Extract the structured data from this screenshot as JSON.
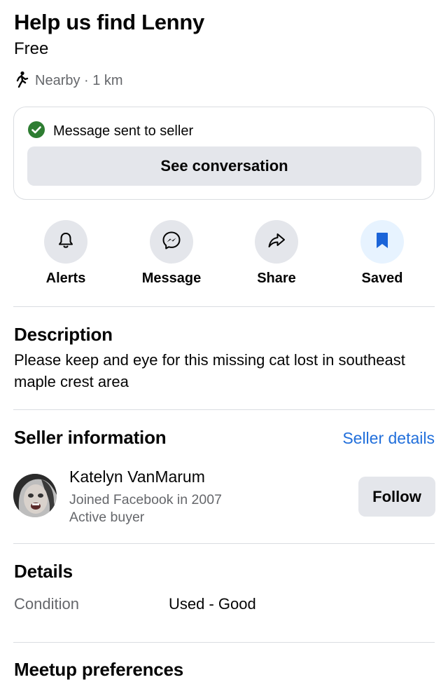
{
  "listing": {
    "title": "Help us find Lenny",
    "price": "Free",
    "distance": "Nearby · 1 km"
  },
  "message_card": {
    "status": "Message sent to seller",
    "button_label": "See conversation"
  },
  "actions": [
    {
      "label": "Alerts",
      "icon": "bell-icon"
    },
    {
      "label": "Message",
      "icon": "messenger-icon"
    },
    {
      "label": "Share",
      "icon": "share-icon"
    },
    {
      "label": "Saved",
      "icon": "bookmark-icon"
    }
  ],
  "description": {
    "heading": "Description",
    "text": "Please keep and eye for this missing cat lost in southeast maple crest area"
  },
  "seller": {
    "heading": "Seller information",
    "details_link": "Seller details",
    "name": "Katelyn VanMarum",
    "joined": "Joined Facebook in 2007",
    "badge": "Active buyer",
    "follow_label": "Follow"
  },
  "details": {
    "heading": "Details",
    "condition_label": "Condition",
    "condition_value": "Used - Good"
  },
  "meetup": {
    "heading": "Meetup preferences"
  },
  "colors": {
    "accent_link": "#216fdb",
    "saved_icon": "#1b64d8",
    "success_check": "#2e7d32",
    "button_bg": "#e4e6eb"
  }
}
